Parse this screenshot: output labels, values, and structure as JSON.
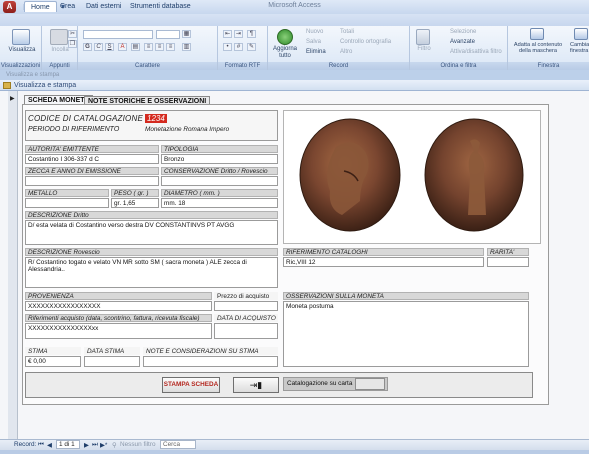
{
  "app": {
    "title": "Microsoft Access",
    "office_button": "A"
  },
  "ribbon": {
    "tabs": [
      "Home",
      "Crea",
      "Dati esterni",
      "Strumenti database"
    ],
    "groups": {
      "views": {
        "button": "Visualizza",
        "label": "Visualizzazioni"
      },
      "clipboard": {
        "paste": "Incolla",
        "label": "Appunti"
      },
      "font": {
        "label": "Carattere",
        "bold": "G",
        "italic": "C",
        "underline": "S",
        "font_color": "A"
      },
      "rich_text": {
        "label": "Formato RTF"
      },
      "records": {
        "label": "Record",
        "refresh": "Aggiorna tutto",
        "new": "Nuovo",
        "save": "Salva",
        "delete": "Elimina",
        "totals": "Totali",
        "spelling": "Controllo ortografia",
        "more": "Altro"
      },
      "sort_filter": {
        "label": "Ordina e filtra",
        "filter": "Filtro",
        "selection": "Selezione",
        "advanced": "Avanzate",
        "toggle": "Attiva/disattiva filtro"
      },
      "window": {
        "label": "Finestra",
        "fit": "Adatta al contenuto della maschera",
        "switch": "Cambia finestra"
      }
    }
  },
  "document": {
    "strip_label": "Visualizza e stampa",
    "tab_label": "Visualizza e stampa"
  },
  "form": {
    "tabs": [
      "SCHEDA MONETA",
      "NOTE STORICHE E OSSERVAZIONI"
    ],
    "code_label": "CODICE DI CATALOGAZIONE",
    "code_value": "1234",
    "period_label": "PERIODO DI RIFERIMENTO",
    "period_value": "Monetazione Romana Impero",
    "fields": {
      "autorita": {
        "label": "AUTORITA' EMITTENTE",
        "value": "Costantino I 306-337 d C"
      },
      "tipologia": {
        "label": "TIPOLOGIA",
        "value": "Bronzo"
      },
      "zecca": {
        "label": "ZECCA E ANNO DI EMISSIONE",
        "value": ""
      },
      "conservazione": {
        "label": "CONSERVAZIONE Dritto / Rovescio",
        "value": ""
      },
      "metallo": {
        "label": "METALLO",
        "value": ""
      },
      "peso": {
        "label": "PESO ( gr. )",
        "value": "gr. 1,65"
      },
      "diametro": {
        "label": "DIAMETRO ( mm. )",
        "value": "mm. 18"
      },
      "dritto": {
        "label": "DESCRIZIONE Dritto",
        "value": "D/ esta velata di Costantino verso destra DV CONSTANTINVS PT AVGG"
      },
      "rovescio": {
        "label": "DESCRIZIONE Rovescio",
        "value": "R/ Costantino togato e velato VN MR sotto SM ( sacra moneta ) ALE zecca di Alessandria.."
      },
      "cataloghi": {
        "label": "RIFERIMENTO CATALOGHI",
        "value": "Ric,VIII 12"
      },
      "rarita": {
        "label": "RARITA'",
        "value": ""
      },
      "provenienza": {
        "label": "PROVENIENZA",
        "value": "XXXXXXXXXXXXXXXXX"
      },
      "prezzo": {
        "label": "Prezzo di acquisto",
        "value": ""
      },
      "riferimenti": {
        "label": "Riferimenti acquisto (data, scontrino, fattura, ricevuta fiscale)",
        "value": "XXXXXXXXXXXXXXXxx"
      },
      "data_acquisto": {
        "label": "DATA DI ACQUISTO",
        "value": ""
      },
      "osservazioni": {
        "label": "OSSERVAZIONI SULLA MONETA",
        "value": "Moneta postuma"
      },
      "stima": {
        "label": "STIMA",
        "value": "€ 0,00"
      },
      "data_stima": {
        "label": "DATA STIMA",
        "value": ""
      },
      "note_stima": {
        "label": "NOTE E CONSIDERAZIONI SU STIMA",
        "value": ""
      }
    },
    "buttons": {
      "print": "STAMPA SCHEDA",
      "exit_icon": "exit-door-icon",
      "print_label": "Catalogazione su carta"
    }
  },
  "nav": {
    "record_label": "Record:",
    "position": "1 di 1",
    "filter": "Nessun filtro",
    "search_placeholder": "Cerca"
  }
}
